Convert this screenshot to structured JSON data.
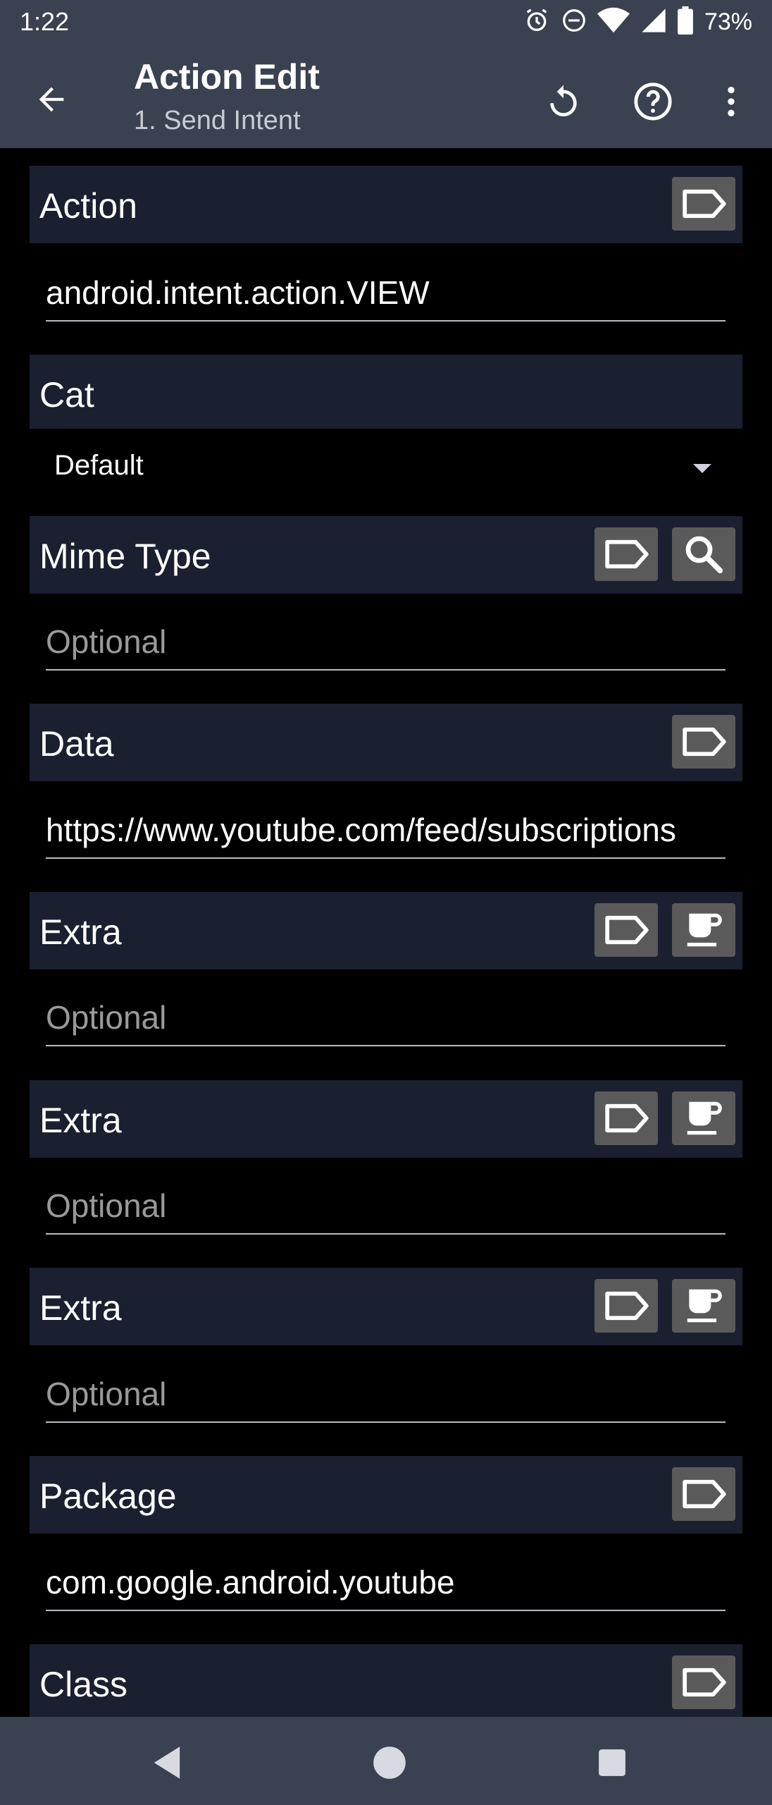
{
  "status_bar": {
    "time": "1:22",
    "battery_percent": "73%",
    "icons": [
      "alarm-icon",
      "dnd-icon",
      "wifi-icon",
      "signal-icon",
      "battery-icon"
    ]
  },
  "app_bar": {
    "title": "Action Edit",
    "subtitle": "1. Send Intent",
    "actions": [
      "undo-icon",
      "help-icon",
      "more-vert-icon"
    ]
  },
  "sections": {
    "action": {
      "label": "Action",
      "value": "android.intent.action.VIEW"
    },
    "cat": {
      "label": "Cat",
      "selected": "Default"
    },
    "mime_type": {
      "label": "Mime Type",
      "placeholder": "Optional"
    },
    "data": {
      "label": "Data",
      "value": "https://www.youtube.com/feed/subscriptions"
    },
    "extra1": {
      "label": "Extra",
      "placeholder": "Optional"
    },
    "extra2": {
      "label": "Extra",
      "placeholder": "Optional"
    },
    "extra3": {
      "label": "Extra",
      "placeholder": "Optional"
    },
    "package": {
      "label": "Package",
      "value": "com.google.android.youtube"
    },
    "class": {
      "label": "Class"
    }
  },
  "colors": {
    "app_bar_bg": "#3a4150",
    "section_header_bg": "#1a2030",
    "button_bg": "#5a5a5a",
    "page_bg": "#000000"
  }
}
